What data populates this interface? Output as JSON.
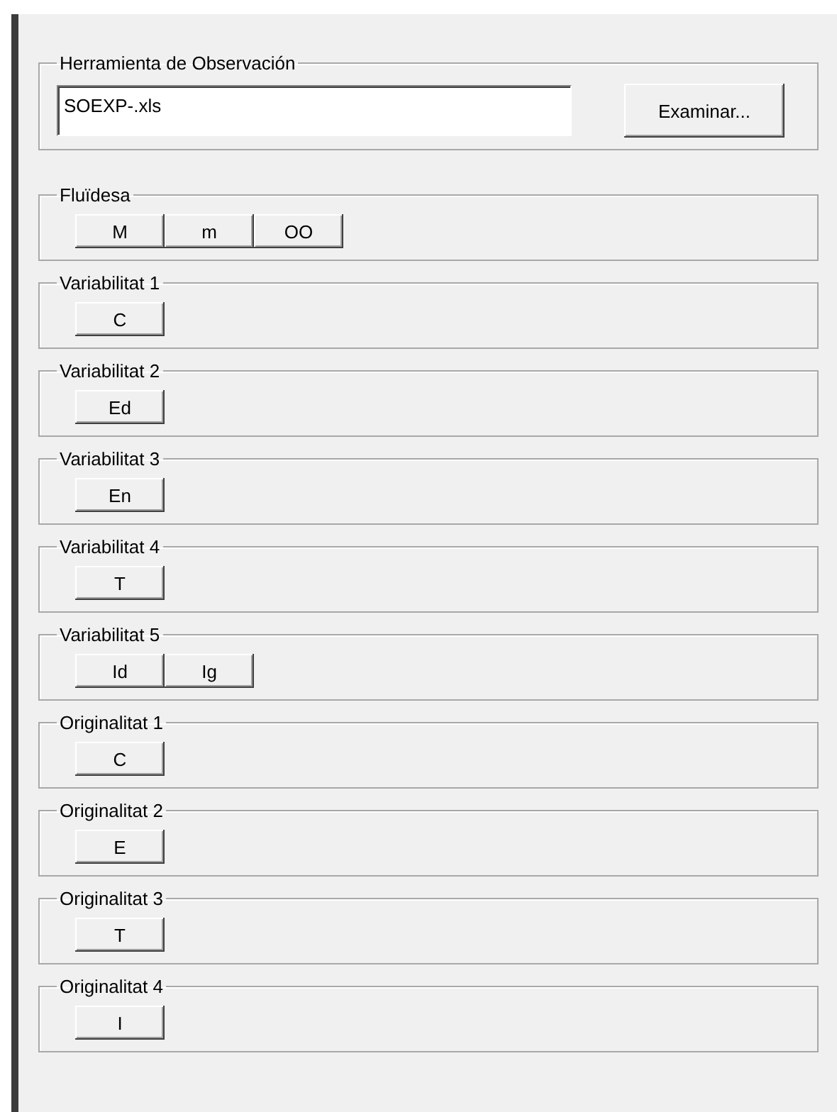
{
  "groups": [
    {
      "title": "Herramienta de Observación",
      "kind": "file",
      "field": {
        "value": "SOEXP-.xls"
      },
      "button": "Examinar..."
    },
    {
      "title": "Fluïdesa",
      "kind": "buttons",
      "buttons": [
        "M",
        "m",
        "OO"
      ]
    },
    {
      "title": "Variabilitat 1",
      "kind": "buttons",
      "buttons": [
        "C"
      ]
    },
    {
      "title": "Variabilitat 2",
      "kind": "buttons",
      "buttons": [
        "Ed"
      ]
    },
    {
      "title": "Variabilitat 3",
      "kind": "buttons",
      "buttons": [
        "En"
      ]
    },
    {
      "title": "Variabilitat 4",
      "kind": "buttons",
      "buttons": [
        "T"
      ]
    },
    {
      "title": "Variabilitat 5",
      "kind": "buttons",
      "buttons": [
        "Id",
        "Ig"
      ]
    },
    {
      "title": "Originalitat 1",
      "kind": "buttons",
      "buttons": [
        "C"
      ]
    },
    {
      "title": "Originalitat 2",
      "kind": "buttons",
      "buttons": [
        "E"
      ]
    },
    {
      "title": "Originalitat 3",
      "kind": "buttons",
      "buttons": [
        "T"
      ]
    },
    {
      "title": "Originalitat 4",
      "kind": "buttons",
      "buttons": [
        "I"
      ]
    }
  ]
}
